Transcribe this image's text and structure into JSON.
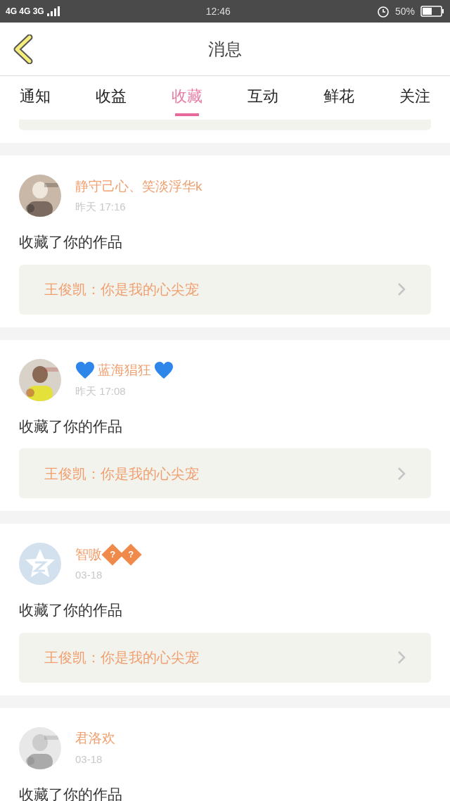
{
  "status_bar": {
    "network": "4G 4G 3G",
    "time": "12:46",
    "battery": "50%"
  },
  "header": {
    "title": "消息"
  },
  "tabs": [
    {
      "label": "通知",
      "selected": false
    },
    {
      "label": "收益",
      "selected": false
    },
    {
      "label": "收藏",
      "selected": true
    },
    {
      "label": "互动",
      "selected": false
    },
    {
      "label": "鲜花",
      "selected": false
    },
    {
      "label": "关注",
      "selected": false
    }
  ],
  "messages": [
    {
      "name": "静守己心、笑淡浮华k",
      "hearts": false,
      "time": "昨天 17:16",
      "action": "收藏了你的作品",
      "quote": "王俊凯：你是我的心尖宠"
    },
    {
      "name": "蓝海猖狂",
      "hearts": true,
      "time": "昨天 17:08",
      "action": "收藏了你的作品",
      "quote": "王俊凯：你是我的心尖宠"
    },
    {
      "avatar": {
        "kind": "default"
      },
      "name": "智嗷",
      "hearts": false,
      "badges": [
        "?",
        "?"
      ],
      "time": "03-18",
      "action": "收藏了你的作品",
      "quote": "王俊凯：你是我的心尖宠"
    },
    {
      "name": "君洛欢",
      "hearts": false,
      "time": "03-18",
      "action": "收藏了你的作品"
    }
  ]
}
